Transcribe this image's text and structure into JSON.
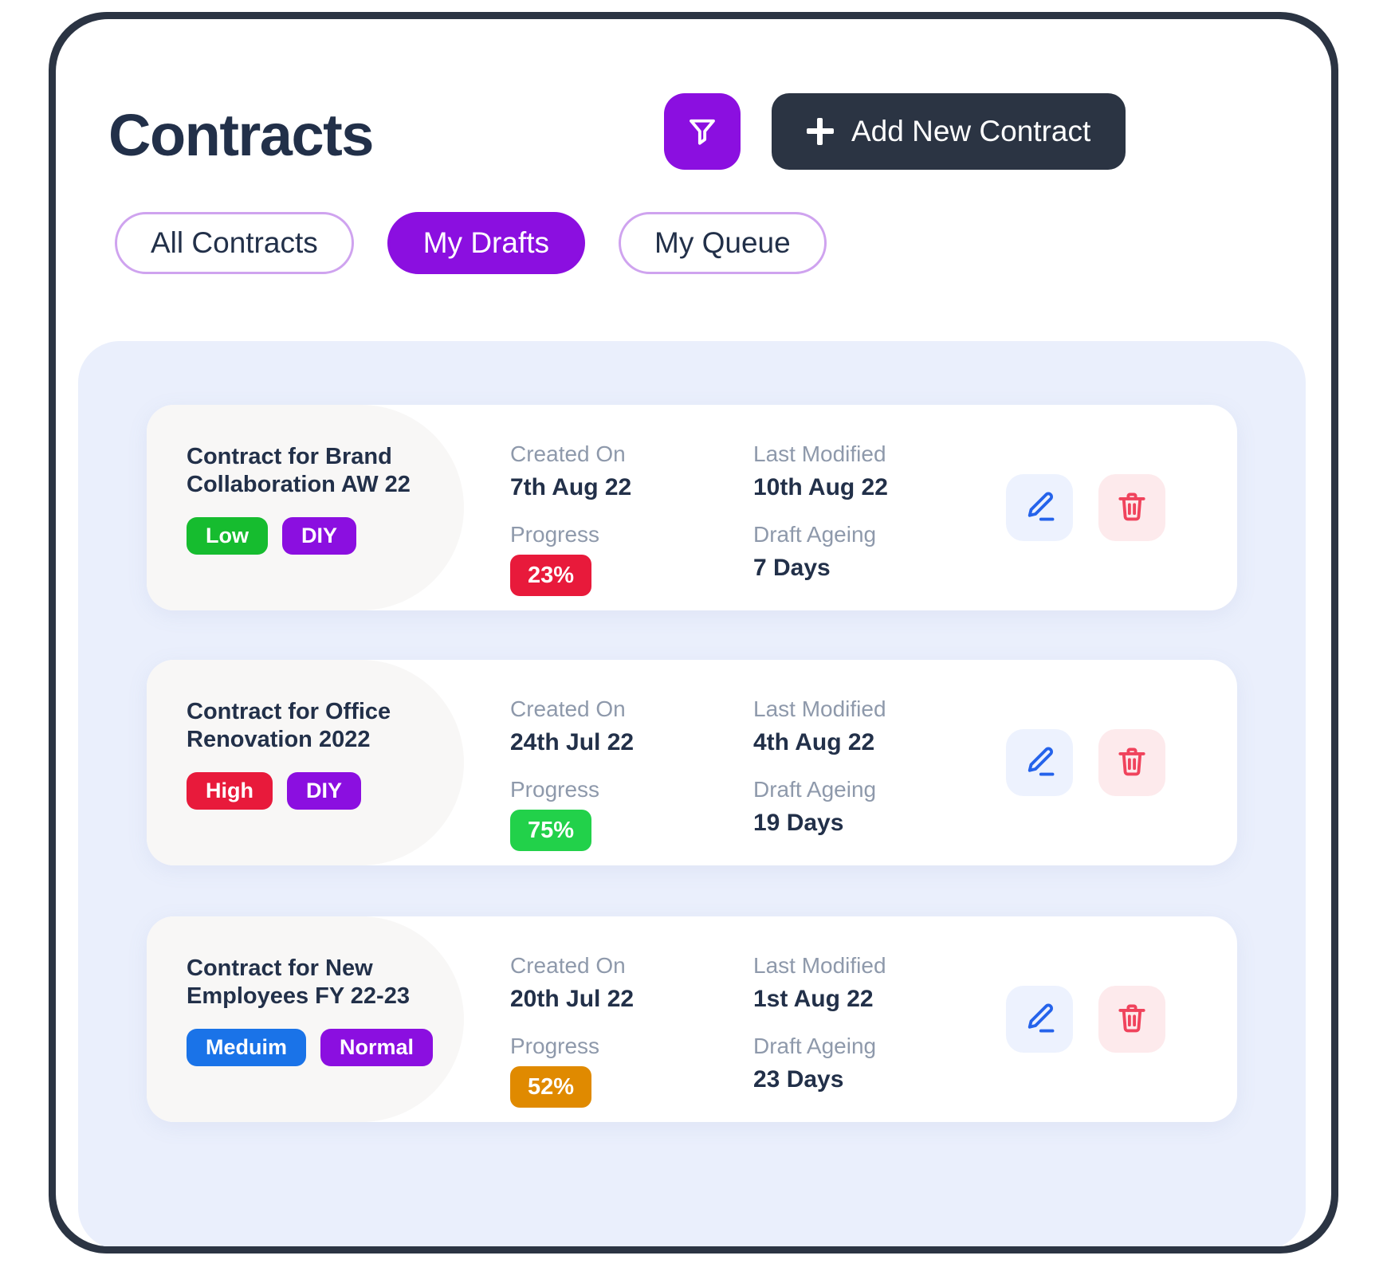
{
  "header": {
    "title": "Contracts",
    "filter_icon": "filter-funnel-icon",
    "add_button_label": "Add New Contract",
    "add_button_icon": "plus-icon"
  },
  "tabs": [
    {
      "label": "All Contracts",
      "active": false
    },
    {
      "label": "My Drafts",
      "active": true
    },
    {
      "label": "My Queue",
      "active": false
    }
  ],
  "labels": {
    "created_on": "Created On",
    "last_modified": "Last Modified",
    "progress": "Progress",
    "draft_ageing": "Draft Ageing"
  },
  "actions": {
    "edit_icon": "pencil-edit-icon",
    "delete_icon": "trash-delete-icon"
  },
  "colors": {
    "accent_purple": "#8B0FE0",
    "dark_navy": "#2b3443",
    "panel_bg": "#eaeffc",
    "tab_border": "#cfa3ef",
    "label_gray": "#8e99ab",
    "edit_blue": "#2563eb",
    "delete_red": "#f0435c",
    "priority_low": "#16bc2f",
    "priority_high": "#e81a3b",
    "priority_medium": "#1a73e8",
    "type_purple": "#8B0FE0",
    "progress_low": "#e81a3b",
    "progress_mid": "#e08a00",
    "progress_high": "#22d14a"
  },
  "cards": [
    {
      "title": "Contract for Brand Collaboration AW 22",
      "priority": {
        "label": "Low",
        "color": "#16bc2f"
      },
      "type": {
        "label": "DIY",
        "color": "#8B0FE0"
      },
      "created_on": "7th Aug 22",
      "last_modified": "10th Aug 22",
      "progress": {
        "label": "23%",
        "color": "#e81a3b"
      },
      "draft_ageing": "7 Days"
    },
    {
      "title": "Contract for Office Renovation 2022",
      "priority": {
        "label": "High",
        "color": "#e81a3b"
      },
      "type": {
        "label": "DIY",
        "color": "#8B0FE0"
      },
      "created_on": "24th Jul 22",
      "last_modified": "4th Aug 22",
      "progress": {
        "label": "75%",
        "color": "#22d14a"
      },
      "draft_ageing": "19 Days"
    },
    {
      "title": "Contract for New Employees FY 22-23",
      "priority": {
        "label": "Meduim",
        "color": "#1a73e8"
      },
      "type": {
        "label": "Normal",
        "color": "#8B0FE0"
      },
      "created_on": "20th Jul 22",
      "last_modified": "1st Aug 22",
      "progress": {
        "label": "52%",
        "color": "#e08a00"
      },
      "draft_ageing": "23 Days"
    }
  ]
}
